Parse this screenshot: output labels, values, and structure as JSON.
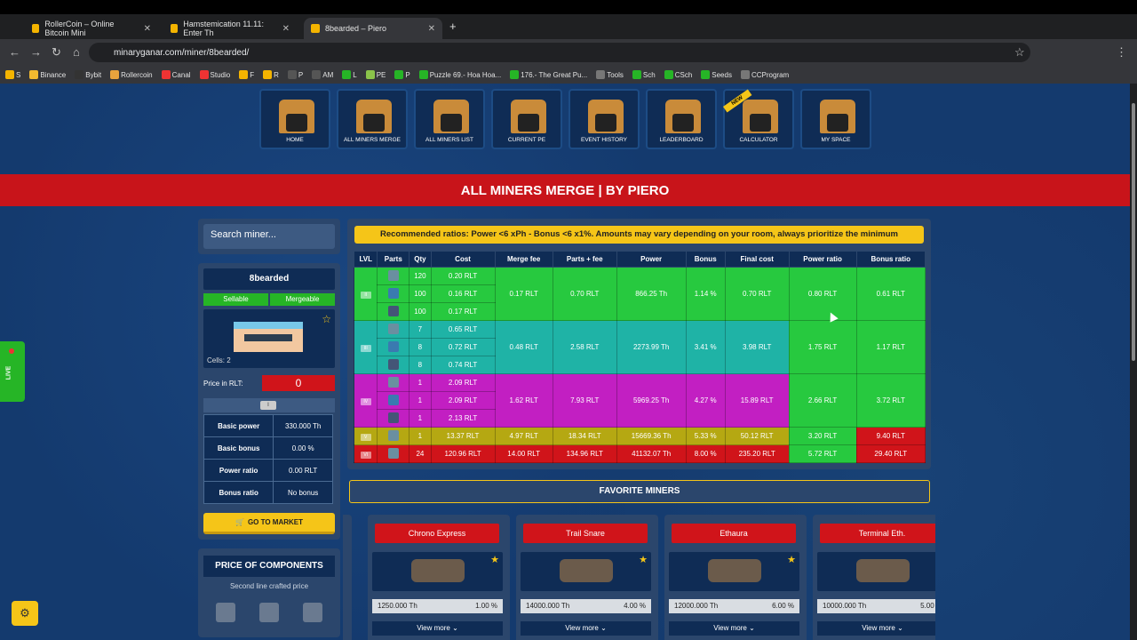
{
  "browser": {
    "tabs": [
      {
        "title": "RollerCoin – Online Bitcoin Mini"
      },
      {
        "title": "Hamstemication 11.11: Enter Th"
      },
      {
        "title": "8bearded – Piero"
      }
    ],
    "url": "minaryganar.com/miner/8bearded/",
    "bookmarks": [
      "S",
      "Binance",
      "Bybit",
      "Rollercoin",
      "Canal",
      "Studio",
      "F",
      "R",
      "P",
      "AM",
      "L",
      "PE",
      "P",
      "Puzzle 69.- Hoa Hoa...",
      "176.- The Great Pu...",
      "Tools",
      "Sch",
      "CSch",
      "Seeds",
      "CCProgram"
    ]
  },
  "nav": [
    {
      "label": "HOME"
    },
    {
      "label": "ALL MINERS MERGE"
    },
    {
      "label": "ALL MINERS LIST"
    },
    {
      "label": "CURRENT PE"
    },
    {
      "label": "EVENT HISTORY"
    },
    {
      "label": "LEADERBOARD"
    },
    {
      "label": "CALCULATOR",
      "new": "NEW"
    },
    {
      "label": "MY SPACE"
    }
  ],
  "banner": "ALL MINERS MERGE | BY PIERO",
  "sidebar": {
    "search_placeholder": "Search miner...",
    "miner_name": "8bearded",
    "tag_sellable": "Sellable",
    "tag_mergeable": "Mergeable",
    "cells": "Cells: 2",
    "price_label": "Price in RLT:",
    "price_value": "0",
    "level_pill": "I",
    "stats": [
      {
        "k": "Basic power",
        "v": "330.000 Th"
      },
      {
        "k": "Basic bonus",
        "v": "0.00 %"
      },
      {
        "k": "Power ratio",
        "v": "0.00 RLT"
      },
      {
        "k": "Bonus ratio",
        "v": "No bonus"
      }
    ],
    "market_button": "GO TO MARKET",
    "components_title": "PRICE OF COMPONENTS",
    "components_subtitle": "Second line crafted price"
  },
  "recommendation": "Recommended ratios: Power <6 xPh - Bonus <6 x1%. Amounts may vary depending on your room, always prioritize the minimum",
  "table": {
    "headers": [
      "LVL",
      "Parts",
      "Qty",
      "Cost",
      "Merge fee",
      "Parts + fee",
      "Power",
      "Bonus",
      "Final cost",
      "Power ratio",
      "Bonus ratio"
    ],
    "groups": [
      {
        "lvl": "II",
        "color": "#27c93f",
        "parts": [
          {
            "qty": "120",
            "cost": "0.20 RLT"
          },
          {
            "qty": "100",
            "cost": "0.16 RLT"
          },
          {
            "qty": "100",
            "cost": "0.17 RLT"
          }
        ],
        "fee": "0.17 RLT",
        "pf": "0.70 RLT",
        "power": "866.25 Th",
        "bonus": "1.14 %",
        "final": "0.70 RLT",
        "pr": "0.80 RLT",
        "br": "0.61 RLT",
        "prc": "#27c93f",
        "brc": "#27c93f"
      },
      {
        "lvl": "III",
        "color": "#1fb3a6",
        "parts": [
          {
            "qty": "7",
            "cost": "0.65 RLT"
          },
          {
            "qty": "8",
            "cost": "0.72 RLT"
          },
          {
            "qty": "8",
            "cost": "0.74 RLT"
          }
        ],
        "fee": "0.48 RLT",
        "pf": "2.58 RLT",
        "power": "2273.99 Th",
        "bonus": "3.41 %",
        "final": "3.98 RLT",
        "pr": "1.75 RLT",
        "br": "1.17 RLT",
        "prc": "#27c93f",
        "brc": "#27c93f"
      },
      {
        "lvl": "IV",
        "color": "#c21fc2",
        "parts": [
          {
            "qty": "1",
            "cost": "2.09 RLT"
          },
          {
            "qty": "1",
            "cost": "2.09 RLT"
          },
          {
            "qty": "1",
            "cost": "2.13 RLT"
          }
        ],
        "fee": "1.62 RLT",
        "pf": "7.93 RLT",
        "power": "5969.25 Th",
        "bonus": "4.27 %",
        "final": "15.89 RLT",
        "pr": "2.66 RLT",
        "br": "3.72 RLT",
        "prc": "#27c93f",
        "brc": "#27c93f"
      },
      {
        "lvl": "V",
        "color": "#b5a812",
        "parts": [
          {
            "qty": "1",
            "cost": "13.37 RLT"
          }
        ],
        "fee": "4.97 RLT",
        "pf": "18.34 RLT",
        "power": "15669.36 Th",
        "bonus": "5.33 %",
        "final": "50.12 RLT",
        "pr": "3.20 RLT",
        "br": "9.40 RLT",
        "prc": "#27c93f",
        "brc": "#d0141a"
      },
      {
        "lvl": "VI",
        "color": "#d0141a",
        "parts": [
          {
            "qty": "24",
            "cost": "120.96 RLT"
          }
        ],
        "fee": "14.00 RLT",
        "pf": "134.96 RLT",
        "power": "41132.07 Th",
        "bonus": "8.00 %",
        "final": "235.20 RLT",
        "pr": "5.72 RLT",
        "br": "29.40 RLT",
        "prc": "#27c93f",
        "brc": "#d0141a"
      }
    ]
  },
  "favorites_title": "FAVORITE MINERS",
  "favorites": [
    {
      "name": "Chrono Express",
      "power": "1250.000 Th",
      "bonus": "1.00 %",
      "more": "View more"
    },
    {
      "name": "Trail Snare",
      "power": "14000.000 Th",
      "bonus": "4.00 %",
      "more": "View more"
    },
    {
      "name": "Ethaura",
      "power": "12000.000 Th",
      "bonus": "6.00 %",
      "more": "View more"
    },
    {
      "name": "Terminal Eth.",
      "power": "10000.000 Th",
      "bonus": "5.00 %",
      "more": "View more"
    }
  ],
  "live": "LIVE",
  "colors": {
    "accent": "#f5c518",
    "banner": "#c8141a",
    "bg": "#143a6e"
  }
}
